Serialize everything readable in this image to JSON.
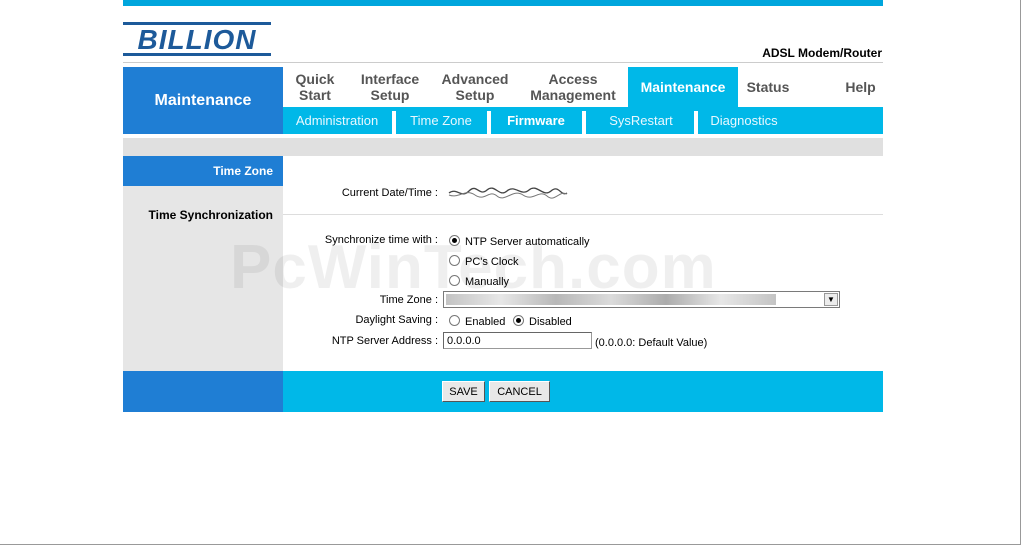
{
  "brand": {
    "logo_text": "BILLION",
    "model": "ADSL Modem/Router"
  },
  "section_title": "Maintenance",
  "nav": {
    "tabs": [
      {
        "line1": "Quick",
        "line2": "Start"
      },
      {
        "line1": "Interface",
        "line2": "Setup"
      },
      {
        "line1": "Advanced",
        "line2": "Setup"
      },
      {
        "line1": "Access",
        "line2": "Management"
      },
      {
        "line1": "Maintenance",
        "line2": ""
      },
      {
        "line1": "Status",
        "line2": ""
      },
      {
        "line1": "Help",
        "line2": ""
      }
    ],
    "subtabs": [
      "Administration",
      "Time Zone",
      "Firmware",
      "SysRestart",
      "Diagnostics"
    ]
  },
  "sidebar": {
    "timezone": "Time Zone",
    "timesync": "Time Synchronization"
  },
  "form": {
    "current_label": "Current Date/Time :",
    "sync_label": "Synchronize time with :",
    "sync_options": [
      "NTP Server automatically",
      "PC's Clock",
      "Manually"
    ],
    "tz_label": "Time Zone :",
    "dst_label": "Daylight Saving :",
    "dst_options": [
      "Enabled",
      "Disabled"
    ],
    "ntp_label": "NTP Server Address :",
    "ntp_value": "0.0.0.0",
    "ntp_hint": "(0.0.0.0: Default Value)"
  },
  "buttons": {
    "save": "SAVE",
    "cancel": "CANCEL"
  },
  "watermark": "PcWinTech.com",
  "colors": {
    "accent_blue": "#1f7ed4",
    "accent_cyan": "#00b8e8",
    "top_strip": "#00a6dd"
  }
}
